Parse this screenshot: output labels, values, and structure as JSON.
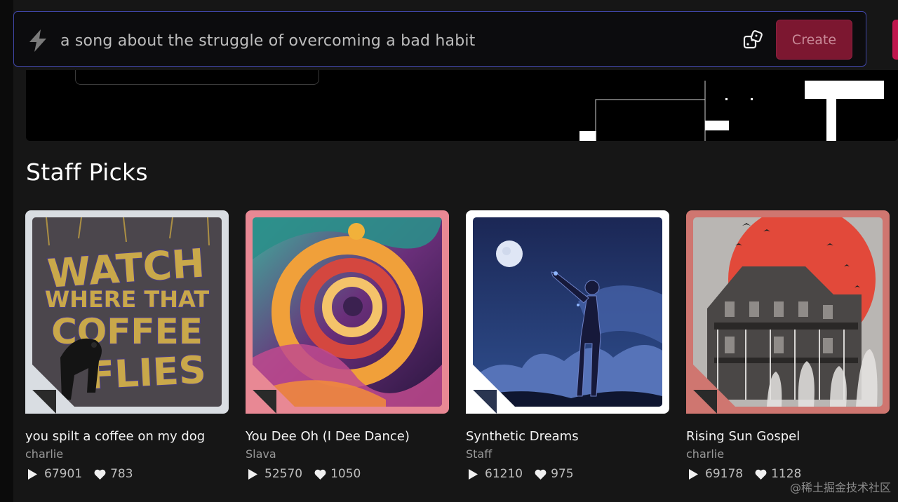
{
  "prompt": {
    "value": "a song about the struggle of overcoming a bad habit",
    "create_label": "Create"
  },
  "section": {
    "title": "Staff Picks"
  },
  "cards": [
    {
      "title": "you spilt a coffee on my dog",
      "author": "charlie",
      "plays": "67901",
      "likes": "783",
      "frame_color": "#d9dde2",
      "cover_text": [
        "WATCH",
        "WHERE THAT",
        "COFFEE",
        "FLIES"
      ]
    },
    {
      "title": "You Dee Oh (I Dee Dance)",
      "author": "Slava",
      "plays": "52570",
      "likes": "1050",
      "frame_color": "#e88894"
    },
    {
      "title": "Synthetic Dreams",
      "author": "Staff",
      "plays": "61210",
      "likes": "975",
      "frame_color": "#ffffff"
    },
    {
      "title": "Rising Sun Gospel",
      "author": "charlie",
      "plays": "69178",
      "likes": "1128",
      "frame_color": "#cf7670"
    }
  ],
  "watermark": "@稀土掘金技术社区",
  "colors": {
    "accent_border": "#4046a8",
    "create_bg": "#7c1730",
    "background": "#161616"
  },
  "icons": [
    "bolt-icon",
    "dice-icon",
    "play-icon",
    "heart-icon"
  ]
}
